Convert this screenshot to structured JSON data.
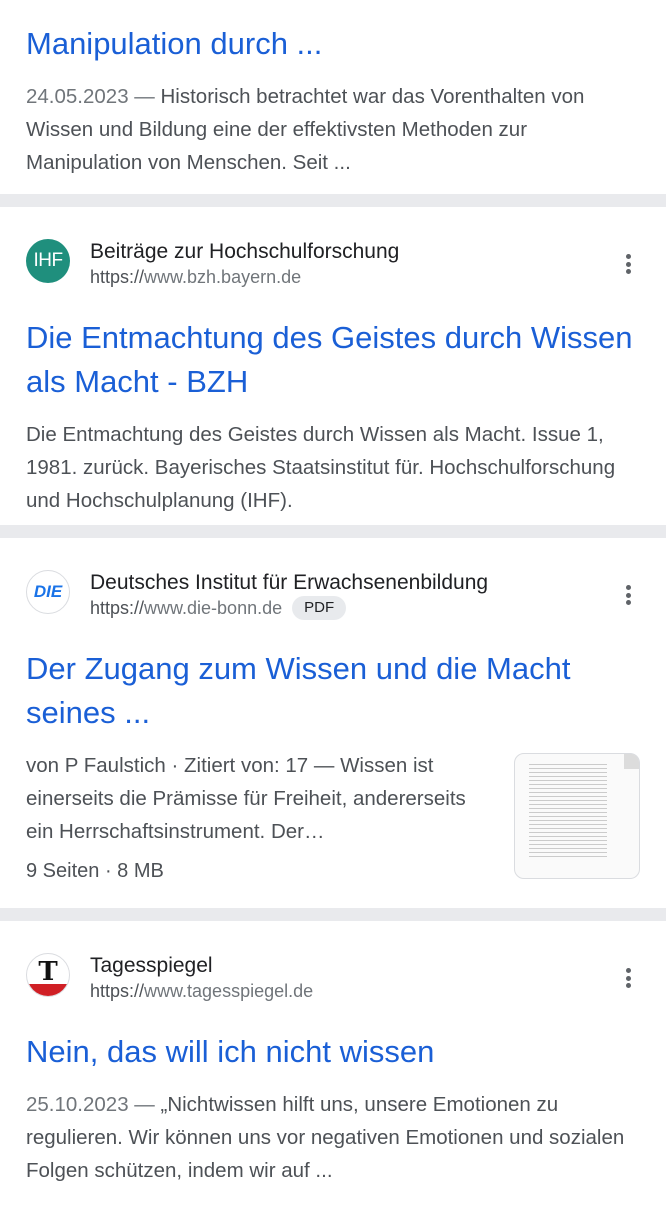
{
  "results": [
    {
      "title": "Manipulation durch ...",
      "date": "24.05.2023 —",
      "snippet": "Historisch betrachtet war das Vorenthalten von Wissen und Bildung eine der effektivsten Methoden zur Manipulation von Menschen. Seit ..."
    },
    {
      "favicon_text": "IHF",
      "site": "Beiträge zur Hochschulforschung",
      "url_scheme": "https://",
      "url_host": "www.bzh.bayern.de",
      "title": "Die Entmachtung des Geistes durch Wissen als Macht - BZH",
      "snippet": "Die Entmachtung des Geistes durch Wissen als Macht. Issue 1, 1981. zurück. Bayerisches Staatsinstitut für. Hochschulforschung und Hochschulplanung (IHF)."
    },
    {
      "favicon_text": "DIE",
      "site": "Deutsches Institut für Erwachsenenbildung",
      "url_scheme": "https://",
      "url_host": "www.die-bonn.de",
      "badge": "PDF",
      "title": "Der Zugang zum Wissen und die Macht seines ...",
      "snippet": "von P Faulstich · Zitiert von: 17 — Wissen ist einerseits die Prämisse für Freiheit, andererseits ein Herrschaftsinstrument. Der…",
      "meta": "9 Seiten · 8 MB"
    },
    {
      "favicon_text": "T",
      "site": "Tagesspiegel",
      "url_scheme": "https://",
      "url_host": "www.tagesspiegel.de",
      "title": "Nein, das will ich nicht wissen",
      "date": "25.10.2023 —",
      "snippet": "„Nichtwissen hilft uns, unsere Emotionen zu regulieren. Wir können uns vor negativen Emotionen und sozialen Folgen schützen, indem wir auf ..."
    }
  ],
  "colors": {
    "link": "#1a5fd6",
    "ihf": "#1f8f7d",
    "tagesspiegel_red": "#d01f25"
  }
}
